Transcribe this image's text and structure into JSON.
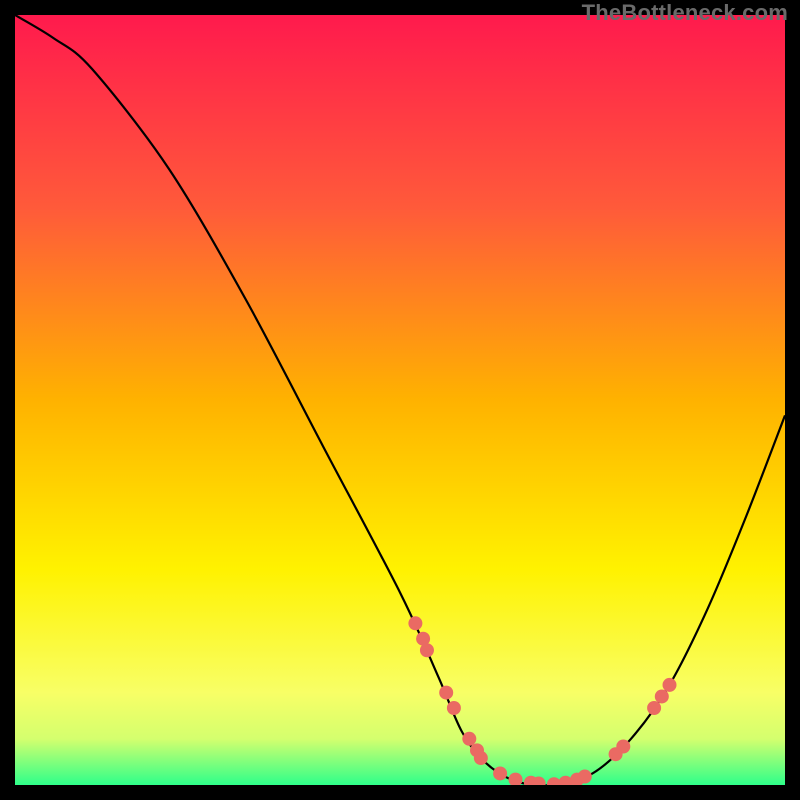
{
  "watermark": "TheBottleneck.com",
  "chart_data": {
    "type": "line",
    "title": "",
    "xlabel": "",
    "ylabel": "",
    "xlim": [
      0,
      100
    ],
    "ylim": [
      0,
      100
    ],
    "curve": [
      {
        "x": 0,
        "y": 100
      },
      {
        "x": 5,
        "y": 97
      },
      {
        "x": 10,
        "y": 93
      },
      {
        "x": 20,
        "y": 80
      },
      {
        "x": 30,
        "y": 63
      },
      {
        "x": 40,
        "y": 44
      },
      {
        "x": 50,
        "y": 25
      },
      {
        "x": 55,
        "y": 14
      },
      {
        "x": 58,
        "y": 7
      },
      {
        "x": 61,
        "y": 3
      },
      {
        "x": 65,
        "y": 0.5
      },
      {
        "x": 70,
        "y": 0
      },
      {
        "x": 75,
        "y": 1.5
      },
      {
        "x": 80,
        "y": 6
      },
      {
        "x": 85,
        "y": 13
      },
      {
        "x": 90,
        "y": 23
      },
      {
        "x": 95,
        "y": 35
      },
      {
        "x": 100,
        "y": 48
      }
    ],
    "markers": [
      {
        "x": 52,
        "y": 21
      },
      {
        "x": 53,
        "y": 19
      },
      {
        "x": 53.5,
        "y": 17.5
      },
      {
        "x": 56,
        "y": 12
      },
      {
        "x": 57,
        "y": 10
      },
      {
        "x": 59,
        "y": 6
      },
      {
        "x": 60,
        "y": 4.5
      },
      {
        "x": 60.5,
        "y": 3.5
      },
      {
        "x": 63,
        "y": 1.5
      },
      {
        "x": 65,
        "y": 0.7
      },
      {
        "x": 67,
        "y": 0.3
      },
      {
        "x": 68,
        "y": 0.2
      },
      {
        "x": 70,
        "y": 0.1
      },
      {
        "x": 71.5,
        "y": 0.3
      },
      {
        "x": 73,
        "y": 0.7
      },
      {
        "x": 74,
        "y": 1.1
      },
      {
        "x": 78,
        "y": 4
      },
      {
        "x": 79,
        "y": 5
      },
      {
        "x": 83,
        "y": 10
      },
      {
        "x": 84,
        "y": 11.5
      },
      {
        "x": 85,
        "y": 13
      }
    ],
    "gradient_stops": [
      {
        "offset": 0,
        "color": "#ff1a4d"
      },
      {
        "offset": 25,
        "color": "#ff5a3a"
      },
      {
        "offset": 50,
        "color": "#ffb200"
      },
      {
        "offset": 72,
        "color": "#fff200"
      },
      {
        "offset": 88,
        "color": "#f8ff66"
      },
      {
        "offset": 94,
        "color": "#d4ff6e"
      },
      {
        "offset": 100,
        "color": "#2eff8a"
      }
    ],
    "curve_color": "#000000",
    "marker_color": "#ea6a63",
    "marker_radius": 7
  }
}
